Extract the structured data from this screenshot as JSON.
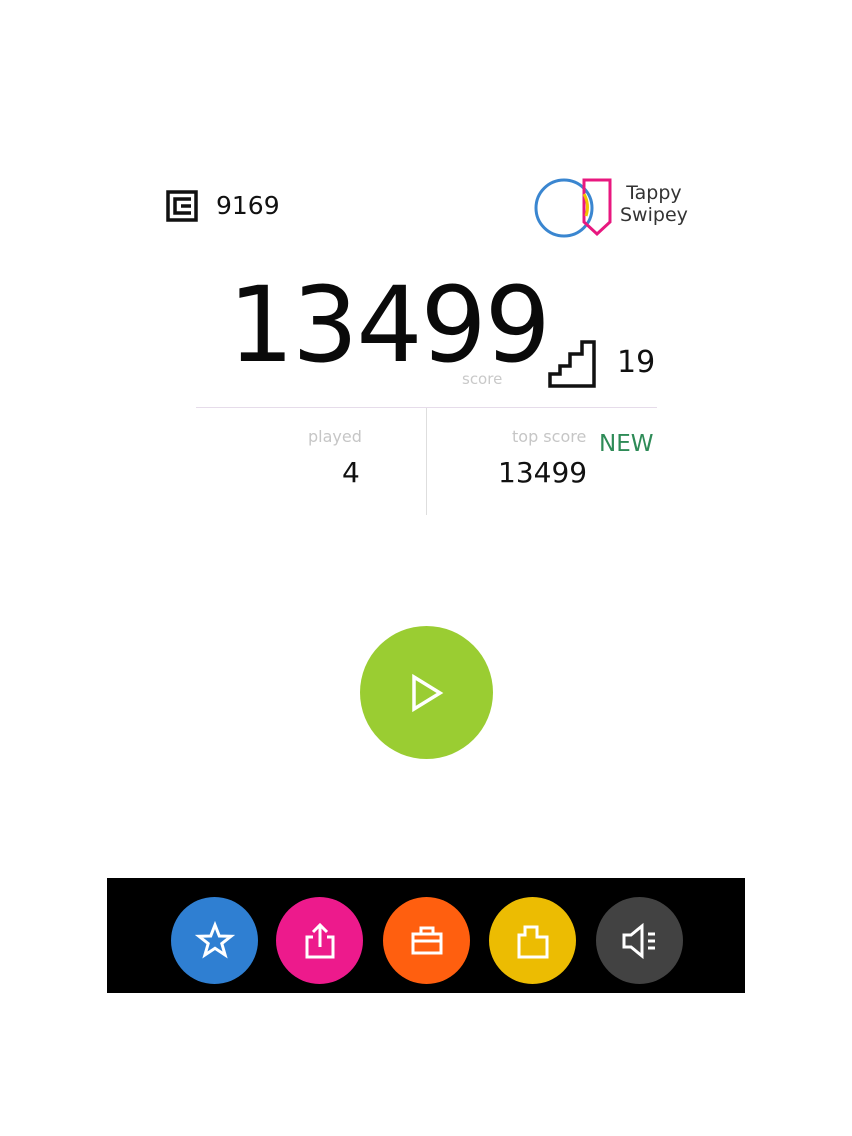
{
  "header": {
    "coins": "9169",
    "coin_icon": "coin-square-icon",
    "logo": {
      "line1": "Tappy",
      "line2": "Swipey",
      "circle_color": "#3a86d0",
      "shield_color": "#e8187f",
      "accent_color": "#f3c300"
    }
  },
  "score": {
    "value": "13499",
    "label": "score",
    "level": "19",
    "level_icon": "stairs-icon"
  },
  "stats": {
    "played_label": "played",
    "played_value": "4",
    "top_label": "top score",
    "top_value": "13499",
    "new_badge": "NEW",
    "new_color": "#2e8b57"
  },
  "play_button": {
    "icon": "play-icon",
    "color": "#9acd32"
  },
  "bottom_bar": {
    "buttons": [
      {
        "icon": "star-icon",
        "color": "#2f7fd2"
      },
      {
        "icon": "share-icon",
        "color": "#ed1a8c"
      },
      {
        "icon": "briefcase-icon",
        "color": "#ff5f0f"
      },
      {
        "icon": "puzzle-icon",
        "color": "#ecbc02"
      },
      {
        "icon": "speaker-icon",
        "color": "#424242"
      }
    ]
  }
}
